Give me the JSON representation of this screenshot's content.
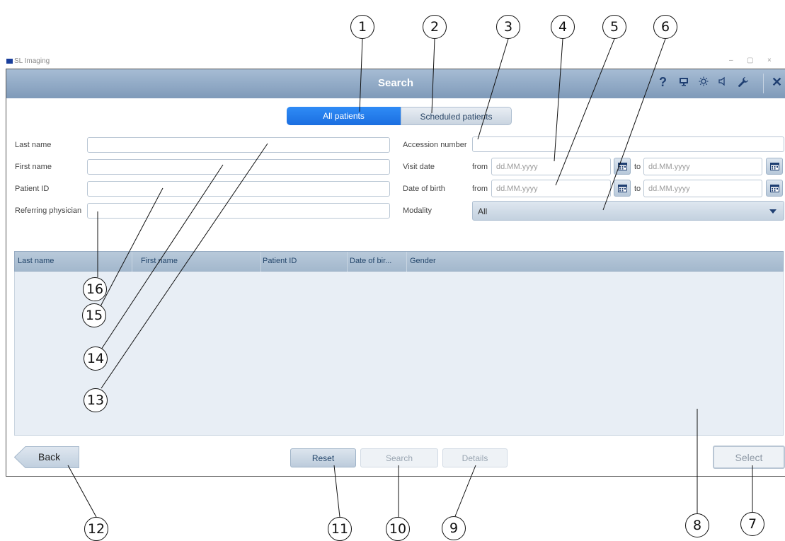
{
  "window": {
    "title": "SL Imaging",
    "min_label": "–",
    "max_label": "▢",
    "close_label": "×"
  },
  "header": {
    "title": "Search",
    "icons": [
      "help-icon",
      "monitor-icon",
      "brightness-icon",
      "speaker-icon",
      "wrench-icon",
      "close-icon"
    ],
    "help_glyph": "?",
    "close_glyph": "✕"
  },
  "tabs": {
    "all_patients": "All patients",
    "scheduled_patients": "Scheduled patients"
  },
  "form": {
    "last_name": {
      "label": "Last name",
      "value": ""
    },
    "first_name": {
      "label": "First name",
      "value": ""
    },
    "patient_id": {
      "label": "Patient ID",
      "value": ""
    },
    "referring_physician": {
      "label": "Referring physician",
      "value": ""
    },
    "accession_number": {
      "label": "Accession number",
      "value": ""
    },
    "visit_date": {
      "label": "Visit date",
      "from_label": "from",
      "to_label": "to",
      "from_placeholder": "dd.MM.yyyy",
      "to_placeholder": "dd.MM.yyyy"
    },
    "date_of_birth": {
      "label": "Date of birth",
      "from_label": "from",
      "to_label": "to",
      "from_placeholder": "dd.MM.yyyy",
      "to_placeholder": "dd.MM.yyyy"
    },
    "modality": {
      "label": "Modality",
      "selected": "All"
    }
  },
  "table": {
    "columns": [
      "Last name",
      "First name",
      "Patient ID",
      "Date of bir...",
      "Gender"
    ],
    "rows": []
  },
  "buttons": {
    "back": "Back",
    "reset": "Reset",
    "search": "Search",
    "details": "Details",
    "select": "Select"
  },
  "callouts": [
    "1",
    "2",
    "3",
    "4",
    "5",
    "6",
    "7",
    "8",
    "9",
    "10",
    "11",
    "12",
    "13",
    "14",
    "15",
    "16"
  ],
  "colors": {
    "accent_blue": "#1b6ee0",
    "header_blue": "#7f9ab9",
    "table_bg": "#e8eef5"
  }
}
